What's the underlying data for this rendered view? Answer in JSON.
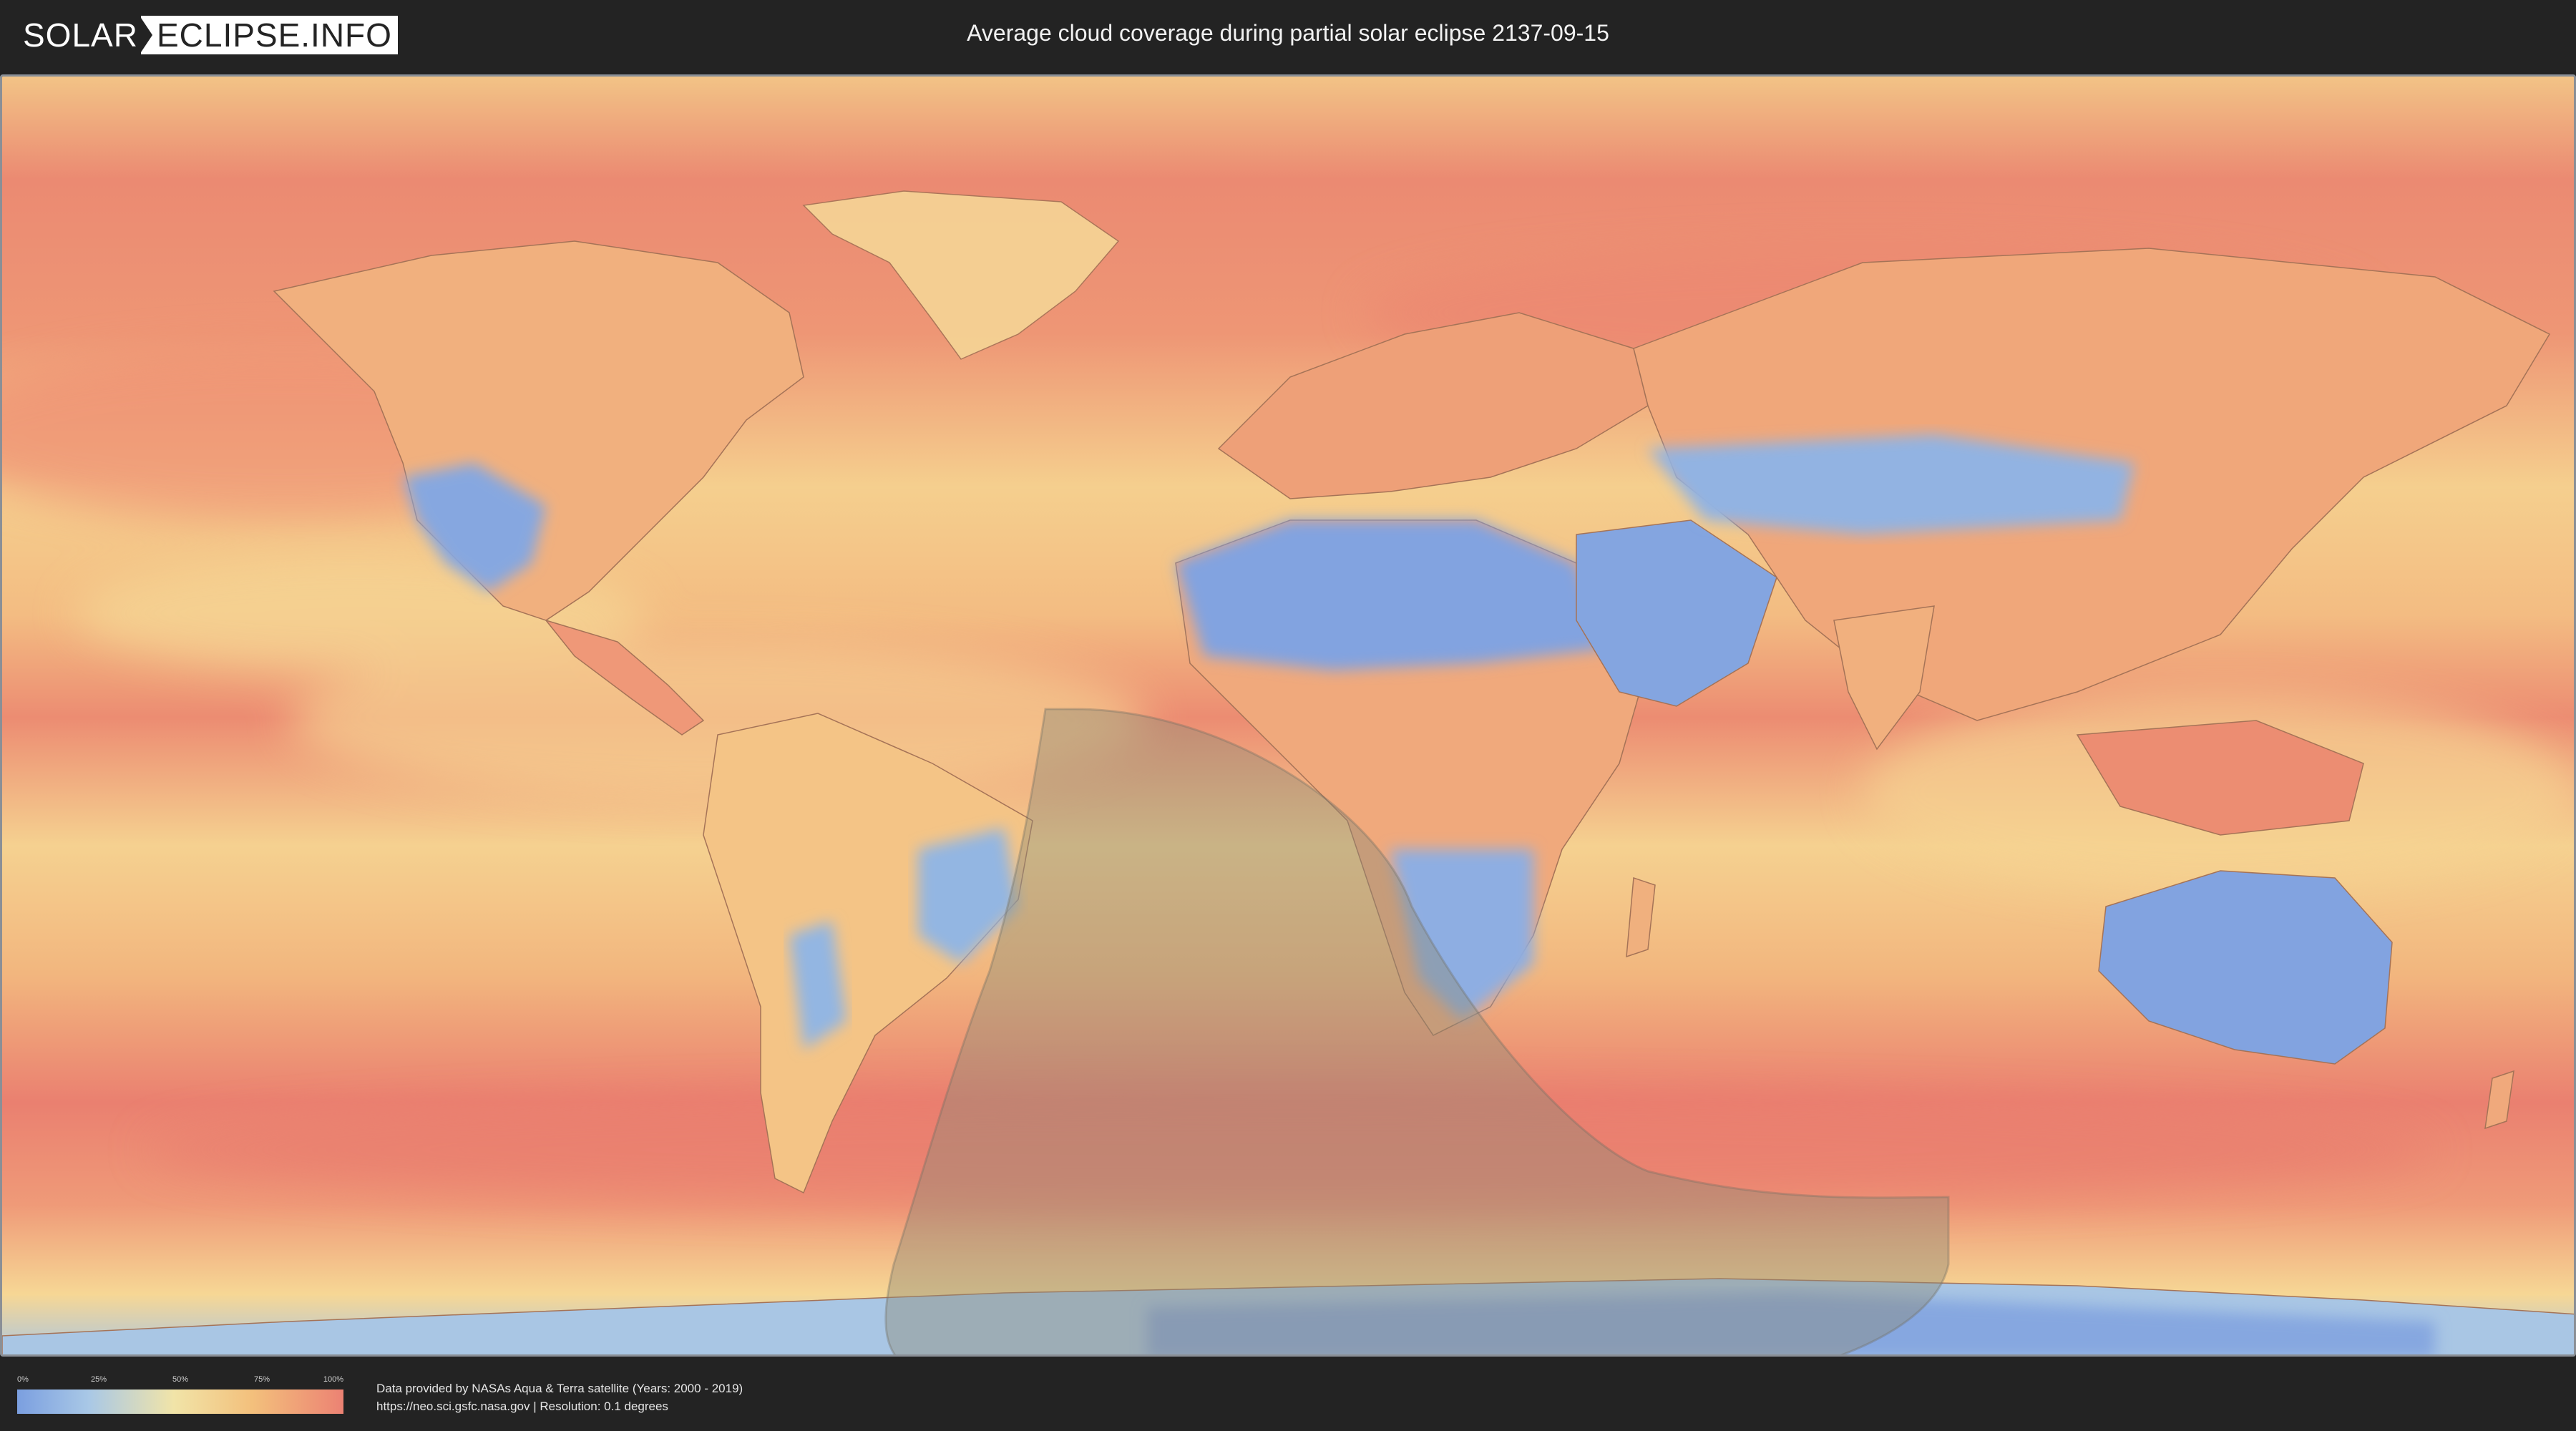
{
  "header": {
    "logo_left": "SOLAR",
    "logo_right": "ECLIPSE.INFO",
    "title": "Average cloud coverage during partial solar eclipse 2137-09-15"
  },
  "legend": {
    "ticks": [
      "0%",
      "25%",
      "50%",
      "75%",
      "100%"
    ],
    "colors": [
      "#7b9fe0",
      "#a9c8e6",
      "#f1e4a8",
      "#f3c07c",
      "#ec8273"
    ]
  },
  "credits": {
    "line1": "Data provided by NASAs Aqua & Terra satellite (Years: 2000 - 2019)",
    "line2": "https://neo.sci.gsfc.nasa.gov | Resolution: 0.1 degrees"
  },
  "map": {
    "eclipse_zone_color": "#8c8a78",
    "ocean_base_color": "#f0a06a"
  }
}
